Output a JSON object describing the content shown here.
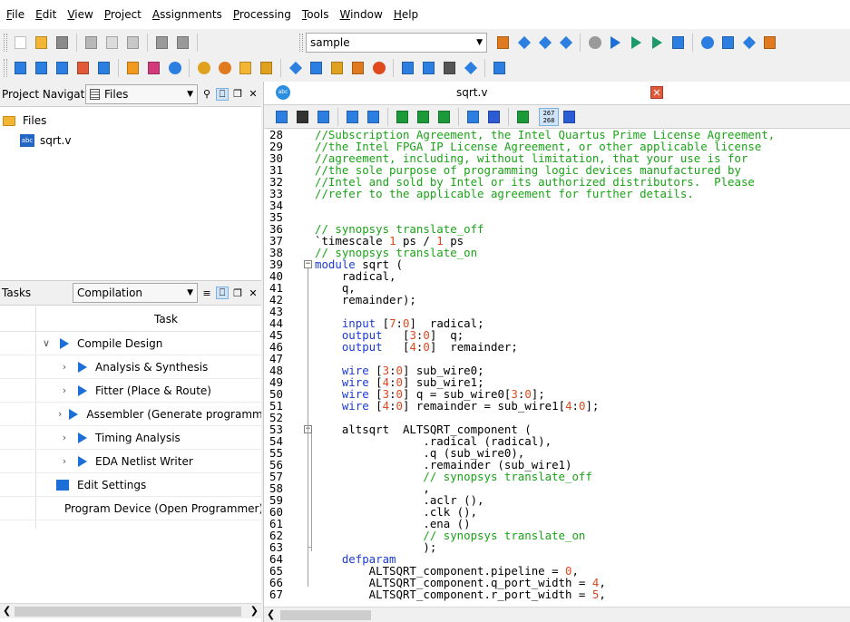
{
  "menu": [
    "File",
    "Edit",
    "View",
    "Project",
    "Assignments",
    "Processing",
    "Tools",
    "Window",
    "Help"
  ],
  "menu_accel": [
    "F",
    "E",
    "V",
    "P",
    "A",
    "P",
    "T",
    "W",
    "H"
  ],
  "project_combo": "sample",
  "project_navigator": {
    "title": "Project Navigator",
    "view_combo": "Files",
    "tree": [
      {
        "label": "Files"
      },
      {
        "label": "sqrt.v"
      }
    ]
  },
  "tasks": {
    "title": "Tasks",
    "flow_combo": "Compilation",
    "column_header": "Task",
    "rows": [
      {
        "label": "Compile Design",
        "level": 0,
        "expander": "v"
      },
      {
        "label": "Analysis & Synthesis",
        "level": 1,
        "expander": ">"
      },
      {
        "label": "Fitter (Place & Route)",
        "level": 1,
        "expander": ">"
      },
      {
        "label": "Assembler (Generate programming files)",
        "level": 1,
        "expander": ">"
      },
      {
        "label": "Timing Analysis",
        "level": 1,
        "expander": ">"
      },
      {
        "label": "EDA Netlist Writer",
        "level": 1,
        "expander": ">"
      },
      {
        "label": "Edit Settings",
        "level": 0,
        "expander": ""
      },
      {
        "label": "Program Device (Open Programmer)",
        "level": 0,
        "expander": ""
      }
    ]
  },
  "editor": {
    "tab_title": "sqrt.v",
    "toolbar_counter_top": "267",
    "toolbar_counter_bottom": "268",
    "lines": [
      {
        "n": "28",
        "fold": "",
        "parts": [
          {
            "t": "//Subscription Agreement, the Intel Quartus Prime License Agreement,",
            "c": "cmt"
          }
        ]
      },
      {
        "n": "29",
        "fold": "",
        "parts": [
          {
            "t": "//the Intel FPGA IP License Agreement, or other applicable license",
            "c": "cmt"
          }
        ]
      },
      {
        "n": "30",
        "fold": "",
        "parts": [
          {
            "t": "//agreement, including, without limitation, that your use is for",
            "c": "cmt"
          }
        ]
      },
      {
        "n": "31",
        "fold": "",
        "parts": [
          {
            "t": "//the sole purpose of programming logic devices manufactured by",
            "c": "cmt"
          }
        ]
      },
      {
        "n": "32",
        "fold": "",
        "parts": [
          {
            "t": "//Intel and sold by Intel or its authorized distributors.  Please",
            "c": "cmt"
          }
        ]
      },
      {
        "n": "33",
        "fold": "",
        "parts": [
          {
            "t": "//refer to the applicable agreement for further details.",
            "c": "cmt"
          }
        ]
      },
      {
        "n": "34",
        "fold": "",
        "parts": []
      },
      {
        "n": "35",
        "fold": "",
        "parts": []
      },
      {
        "n": "36",
        "fold": "",
        "parts": [
          {
            "t": "// synopsys translate_off",
            "c": "cmt"
          }
        ]
      },
      {
        "n": "37",
        "fold": "",
        "parts": [
          {
            "t": "`timescale ",
            "c": ""
          },
          {
            "t": "1",
            "c": "num"
          },
          {
            "t": " ps / ",
            "c": ""
          },
          {
            "t": "1",
            "c": "num"
          },
          {
            "t": " ps",
            "c": ""
          }
        ]
      },
      {
        "n": "38",
        "fold": "",
        "parts": [
          {
            "t": "// synopsys translate_on",
            "c": "cmt"
          }
        ]
      },
      {
        "n": "39",
        "fold": "-",
        "parts": [
          {
            "t": "module",
            "c": "kw"
          },
          {
            "t": " sqrt (",
            "c": ""
          }
        ]
      },
      {
        "n": "40",
        "fold": "",
        "parts": [
          {
            "t": "    radical,",
            "c": ""
          }
        ]
      },
      {
        "n": "41",
        "fold": "",
        "parts": [
          {
            "t": "    q,",
            "c": ""
          }
        ]
      },
      {
        "n": "42",
        "fold": "",
        "parts": [
          {
            "t": "    remainder);",
            "c": ""
          }
        ]
      },
      {
        "n": "43",
        "fold": "",
        "parts": []
      },
      {
        "n": "44",
        "fold": "",
        "parts": [
          {
            "t": "    ",
            "c": ""
          },
          {
            "t": "input",
            "c": "kw"
          },
          {
            "t": " [",
            "c": ""
          },
          {
            "t": "7",
            "c": "num"
          },
          {
            "t": ":",
            "c": ""
          },
          {
            "t": "0",
            "c": "num"
          },
          {
            "t": "]  radical;",
            "c": ""
          }
        ]
      },
      {
        "n": "45",
        "fold": "",
        "parts": [
          {
            "t": "    ",
            "c": ""
          },
          {
            "t": "output",
            "c": "kw"
          },
          {
            "t": "   [",
            "c": ""
          },
          {
            "t": "3",
            "c": "num"
          },
          {
            "t": ":",
            "c": ""
          },
          {
            "t": "0",
            "c": "num"
          },
          {
            "t": "]  q;",
            "c": ""
          }
        ]
      },
      {
        "n": "46",
        "fold": "",
        "parts": [
          {
            "t": "    ",
            "c": ""
          },
          {
            "t": "output",
            "c": "kw"
          },
          {
            "t": "   [",
            "c": ""
          },
          {
            "t": "4",
            "c": "num"
          },
          {
            "t": ":",
            "c": ""
          },
          {
            "t": "0",
            "c": "num"
          },
          {
            "t": "]  remainder;",
            "c": ""
          }
        ]
      },
      {
        "n": "47",
        "fold": "",
        "parts": []
      },
      {
        "n": "48",
        "fold": "",
        "parts": [
          {
            "t": "    ",
            "c": ""
          },
          {
            "t": "wire",
            "c": "kw"
          },
          {
            "t": " [",
            "c": ""
          },
          {
            "t": "3",
            "c": "num"
          },
          {
            "t": ":",
            "c": ""
          },
          {
            "t": "0",
            "c": "num"
          },
          {
            "t": "] sub_wire0;",
            "c": ""
          }
        ]
      },
      {
        "n": "49",
        "fold": "",
        "parts": [
          {
            "t": "    ",
            "c": ""
          },
          {
            "t": "wire",
            "c": "kw"
          },
          {
            "t": " [",
            "c": ""
          },
          {
            "t": "4",
            "c": "num"
          },
          {
            "t": ":",
            "c": ""
          },
          {
            "t": "0",
            "c": "num"
          },
          {
            "t": "] sub_wire1;",
            "c": ""
          }
        ]
      },
      {
        "n": "50",
        "fold": "",
        "parts": [
          {
            "t": "    ",
            "c": ""
          },
          {
            "t": "wire",
            "c": "kw"
          },
          {
            "t": " [",
            "c": ""
          },
          {
            "t": "3",
            "c": "num"
          },
          {
            "t": ":",
            "c": ""
          },
          {
            "t": "0",
            "c": "num"
          },
          {
            "t": "] q = sub_wire0[",
            "c": ""
          },
          {
            "t": "3",
            "c": "num"
          },
          {
            "t": ":",
            "c": ""
          },
          {
            "t": "0",
            "c": "num"
          },
          {
            "t": "];",
            "c": ""
          }
        ]
      },
      {
        "n": "51",
        "fold": "",
        "parts": [
          {
            "t": "    ",
            "c": ""
          },
          {
            "t": "wire",
            "c": "kw"
          },
          {
            "t": " [",
            "c": ""
          },
          {
            "t": "4",
            "c": "num"
          },
          {
            "t": ":",
            "c": ""
          },
          {
            "t": "0",
            "c": "num"
          },
          {
            "t": "] remainder = sub_wire1[",
            "c": ""
          },
          {
            "t": "4",
            "c": "num"
          },
          {
            "t": ":",
            "c": ""
          },
          {
            "t": "0",
            "c": "num"
          },
          {
            "t": "];",
            "c": ""
          }
        ]
      },
      {
        "n": "52",
        "fold": "",
        "parts": []
      },
      {
        "n": "53",
        "fold": "-",
        "parts": [
          {
            "t": "    altsqrt  ALTSQRT_component (",
            "c": ""
          }
        ]
      },
      {
        "n": "54",
        "fold": "",
        "parts": [
          {
            "t": "                .radical (radical),",
            "c": ""
          }
        ]
      },
      {
        "n": "55",
        "fold": "",
        "parts": [
          {
            "t": "                .q (sub_wire0),",
            "c": ""
          }
        ]
      },
      {
        "n": "56",
        "fold": "",
        "parts": [
          {
            "t": "                .remainder (sub_wire1)",
            "c": ""
          }
        ]
      },
      {
        "n": "57",
        "fold": "",
        "parts": [
          {
            "t": "                ",
            "c": ""
          },
          {
            "t": "// synopsys translate_off",
            "c": "cmt"
          }
        ]
      },
      {
        "n": "58",
        "fold": "",
        "parts": [
          {
            "t": "                ,",
            "c": ""
          }
        ]
      },
      {
        "n": "59",
        "fold": "",
        "parts": [
          {
            "t": "                .aclr (),",
            "c": ""
          }
        ]
      },
      {
        "n": "60",
        "fold": "",
        "parts": [
          {
            "t": "                .clk (),",
            "c": ""
          }
        ]
      },
      {
        "n": "61",
        "fold": "",
        "parts": [
          {
            "t": "                .ena ()",
            "c": ""
          }
        ]
      },
      {
        "n": "62",
        "fold": "",
        "parts": [
          {
            "t": "                ",
            "c": ""
          },
          {
            "t": "// synopsys translate_on",
            "c": "cmt"
          }
        ]
      },
      {
        "n": "63",
        "fold": "",
        "parts": [
          {
            "t": "                );",
            "c": ""
          }
        ]
      },
      {
        "n": "64",
        "fold": "",
        "parts": [
          {
            "t": "    ",
            "c": ""
          },
          {
            "t": "defparam",
            "c": "kw"
          }
        ]
      },
      {
        "n": "65",
        "fold": "",
        "parts": [
          {
            "t": "        ALTSQRT_component.pipeline = ",
            "c": ""
          },
          {
            "t": "0",
            "c": "num"
          },
          {
            "t": ",",
            "c": ""
          }
        ]
      },
      {
        "n": "66",
        "fold": "",
        "parts": [
          {
            "t": "        ALTSQRT_component.q_port_width = ",
            "c": ""
          },
          {
            "t": "4",
            "c": "num"
          },
          {
            "t": ",",
            "c": ""
          }
        ]
      },
      {
        "n": "67",
        "fold": "",
        "parts": [
          {
            "t": "        ALTSQRT_component.r_port_width = ",
            "c": ""
          },
          {
            "t": "5",
            "c": "num"
          },
          {
            "t": ",",
            "c": ""
          }
        ]
      }
    ]
  },
  "icons": {
    "toolbar1": [
      "new-file-icon",
      "open-folder-icon",
      "save-icon",
      "cut-icon",
      "copy-icon",
      "paste-icon",
      "undo-icon",
      "redo-icon"
    ],
    "toolbar1_right": [
      "settings-wand-icon",
      "pin-planner-icon",
      "assignment-editor-icon",
      "chip-planner-icon",
      "stop-icon",
      "start-compilation-icon",
      "analysis-icon",
      "fitter-icon",
      "assembler-icon",
      "timing-analyzer-icon",
      "netlist-viewer-icon",
      "programmer-icon",
      "platform-designer-icon"
    ],
    "toolbar2": [
      "sim-icon-1",
      "sim-icon-2",
      "sim-icon-3",
      "sim-icon-4",
      "sim-icon-5",
      "power-icon",
      "grid-icon",
      "clock-icon",
      "ip-icon-1",
      "ip-icon-2",
      "ip-icon-3",
      "ip-icon-4",
      "chip-icon-1",
      "chip-icon-2",
      "chip-icon-3",
      "chip-icon-4",
      "chip-icon-5",
      "wave-icon",
      "bus-icon",
      "memory-icon",
      "programmer-small-icon",
      "hierarchy-icon"
    ]
  },
  "colors": {
    "keyword": "#1c3ad6",
    "comment": "#1aa317",
    "number": "#e0481e",
    "task_play": "#1c6fd6"
  }
}
